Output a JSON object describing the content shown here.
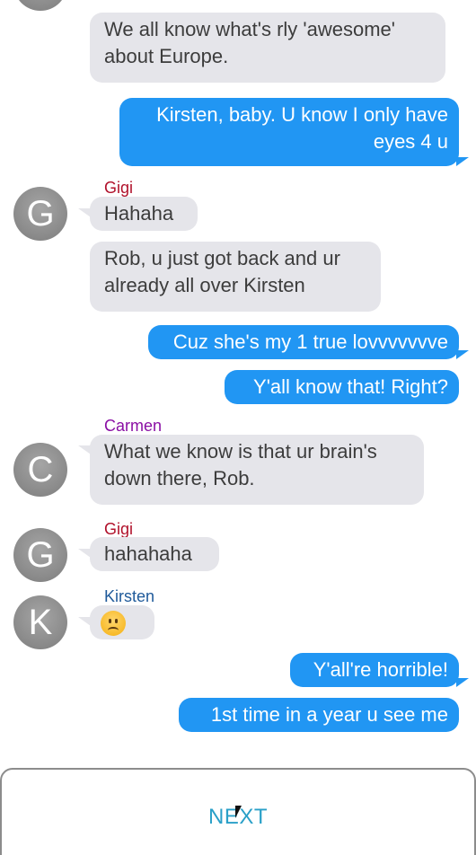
{
  "colors": {
    "incoming_bubble": "#e5e5ea",
    "outgoing_bubble": "#2196f3",
    "name_gigi": "#b0102a",
    "name_carmen": "#8a0fa4",
    "name_kirsten": "#1f5a9a",
    "next_text": "#2aa0c8"
  },
  "messages": [
    {
      "direction": "in",
      "text": "We all know what's rly 'awesome' about Europe."
    },
    {
      "direction": "out",
      "text": "Kirsten, baby. U know I only have eyes 4 u"
    },
    {
      "direction": "in",
      "sender": "Gigi",
      "avatar_letter": "G",
      "text": "Hahaha"
    },
    {
      "direction": "in",
      "text": "Rob, u just got back and ur already all over Kirsten"
    },
    {
      "direction": "out",
      "text": "Cuz she's my 1 true lovvvvvvve"
    },
    {
      "direction": "out",
      "text": "Y'all know that! Right?"
    },
    {
      "direction": "in",
      "sender": "Carmen",
      "avatar_letter": "C",
      "text": "What we know is that ur brain's down there, Rob."
    },
    {
      "direction": "in",
      "sender": "Gigi",
      "avatar_letter": "G",
      "text": "hahahaha"
    },
    {
      "direction": "in",
      "sender": "Kirsten",
      "avatar_letter": "K",
      "emoji": "frowning-face-emoji"
    },
    {
      "direction": "out",
      "text": "Y'all're horrible!"
    },
    {
      "direction": "out",
      "text": "1st time in a year u see me"
    }
  ],
  "footer": {
    "next_label": "NEXT"
  }
}
